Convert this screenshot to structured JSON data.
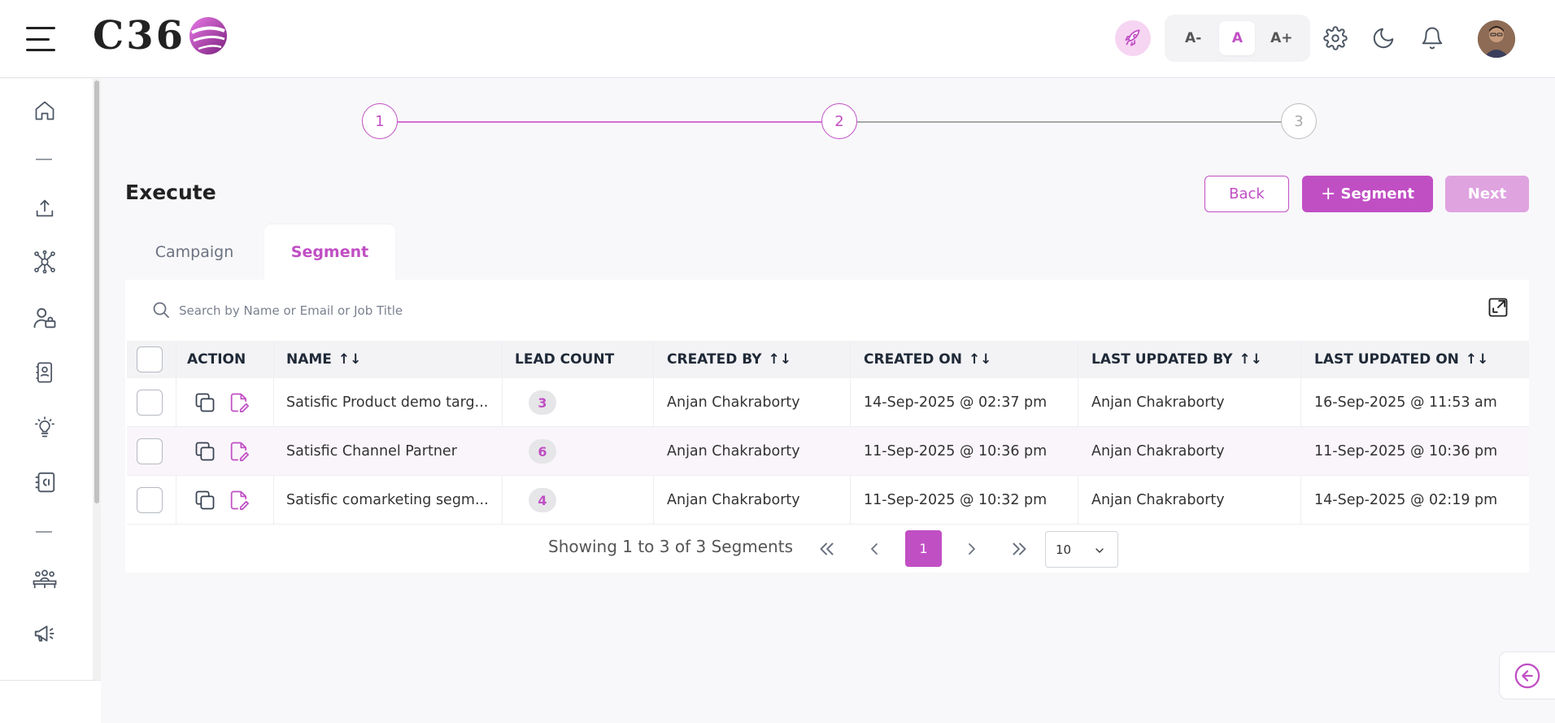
{
  "header": {
    "logo_text": "C36",
    "font_controls": {
      "decrease": "A-",
      "normal": "A",
      "increase": "A+"
    }
  },
  "stepper": {
    "steps": [
      "1",
      "2",
      "3"
    ],
    "current": 2
  },
  "page": {
    "title": "Execute"
  },
  "actions": {
    "back": "Back",
    "add_segment": "Segment",
    "add_segment_prefix": "+",
    "next": "Next"
  },
  "tabs": {
    "campaign": "Campaign",
    "segment": "Segment",
    "active": "segment"
  },
  "search": {
    "placeholder": "Search by Name or Email or Job Title",
    "value": ""
  },
  "table": {
    "columns": {
      "action": "ACTION",
      "name": "NAME",
      "lead_count": "LEAD COUNT",
      "created_by": "CREATED BY",
      "created_on": "CREATED ON",
      "last_updated_by": "LAST UPDATED BY",
      "last_updated_on": "LAST UPDATED ON"
    },
    "sort_glyph": "↑↓",
    "rows": [
      {
        "name": "Satisfic Product demo targ...",
        "lead_count": "3",
        "created_by": "Anjan Chakraborty",
        "created_on": "14-Sep-2025 @ 02:37 pm",
        "last_updated_by": "Anjan Chakraborty",
        "last_updated_on": "16-Sep-2025 @ 11:53 am"
      },
      {
        "name": "Satisfic Channel Partner",
        "lead_count": "6",
        "created_by": "Anjan Chakraborty",
        "created_on": "11-Sep-2025 @ 10:36 pm",
        "last_updated_by": "Anjan Chakraborty",
        "last_updated_on": "11-Sep-2025 @ 10:36 pm"
      },
      {
        "name": "Satisfic comarketing segm...",
        "lead_count": "4",
        "created_by": "Anjan Chakraborty",
        "created_on": "11-Sep-2025 @ 10:32 pm",
        "last_updated_by": "Anjan Chakraborty",
        "last_updated_on": "14-Sep-2025 @ 02:19 pm"
      }
    ]
  },
  "pagination": {
    "summary": "Showing 1 to 3 of 3 Segments",
    "current_page": "1",
    "page_size": "10"
  },
  "colors": {
    "accent": "#c04fc4",
    "accent_light": "#dfa3e0",
    "badge_bg": "#e6e6e9"
  },
  "icons": {
    "sidebar": [
      "home-icon",
      "upload-icon",
      "network-icon",
      "user-role-icon",
      "contact-card-icon",
      "lightbulb-icon",
      "campaign-card-icon",
      "group-icon",
      "megaphone-icon"
    ],
    "header": [
      "menu-icon",
      "rocket-icon",
      "gear-icon",
      "moon-icon",
      "bell-icon"
    ]
  }
}
